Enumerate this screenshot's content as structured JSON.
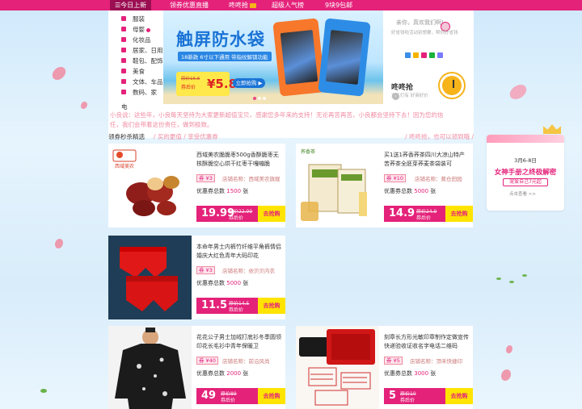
{
  "nav": {
    "items": [
      {
        "label": "今日上新",
        "active": true,
        "icon": "menu-icon"
      },
      {
        "label": "领券优惠直播",
        "active": false
      },
      {
        "label": "咚咚抢",
        "active": false
      },
      {
        "label": "超级人气榜",
        "active": false
      },
      {
        "label": "9块9包邮",
        "active": false
      }
    ],
    "active_color": "#9b0e52",
    "bar_color": "#e4227a"
  },
  "categories": [
    {
      "label": "服装",
      "icon": "clothes-icon"
    },
    {
      "label": "母婴",
      "icon": "baby-icon",
      "hot": true
    },
    {
      "label": "化妆品",
      "icon": "cosmetics-icon"
    },
    {
      "label": "居家、日用",
      "icon": "home-icon"
    },
    {
      "label": "鞋包、配饰",
      "icon": "shoe-icon"
    },
    {
      "label": "美食",
      "icon": "food-icon"
    },
    {
      "label": "文体、车品",
      "icon": "sports-icon"
    },
    {
      "label": "数码、家",
      "icon": "digital-icon"
    }
  ],
  "category_tail": "电",
  "banner": {
    "title": "触屏防水袋",
    "subtitle": "18新款 6寸以下通用 带指纹解锁功能",
    "coupon_orig": "原价15.8",
    "coupon_after": "券后价",
    "coupon_price": "¥5.8",
    "buy_label": "立即抢购 ▶"
  },
  "login": {
    "greeting": "亲你，真欢我们啊!",
    "sub": "好省钱啦活动别想要，帮你好省钱",
    "ddq_title": "咚咚抢",
    "ddq_sub": "女王们有 好商好价"
  },
  "notice": {
    "line1": "小良说：这些年，小良每天坚持为大家更新超值宝贝，感谢您多年来的支持！无论再苦再苦，小良都会坚持下去！因为您的信",
    "line2": "任，我们会带着这份责任，做到极致。"
  },
  "section": {
    "title": "领券秒杀精选",
    "slogan": "/ 买的更值 / 享受优惠券",
    "right": "/ 咚咚抢，也可以领到哦 /"
  },
  "products": [
    {
      "title": "西域美农脆脆枣500g香酥脆枣无核酥脆空心烘干红枣干嘎嘣脆",
      "coupon": "券 ¥3",
      "shop": "店铺名称：西域美农旗舰",
      "sold_label": "优惠券总数",
      "sold_count": "1500",
      "sold_unit": "张",
      "price": "19.99",
      "orig": "原价22.99",
      "after": "券后价",
      "btn": "去抢购",
      "brand": "西域美农"
    },
    {
      "title": "买1送1荞香荞茶四川大凉山特产苦荞茶全胚芽荞麦茶袋装可",
      "coupon": "券 ¥10",
      "shop": "店铺名称：蕉仓田园",
      "sold_label": "优惠券总数",
      "sold_count": "5000",
      "sold_unit": "张",
      "price": "14.9",
      "orig": "原价24.9",
      "after": "券后价",
      "btn": "去抢购",
      "brand": "荞香茶"
    },
    {
      "title": "本命年男士内裤竹纤维平角裤情侣婚庆大红色青年大码印花",
      "coupon": "券 ¥3",
      "shop": "店铺名称：依贝贝内衣",
      "sold_label": "优惠券总数",
      "sold_count": "5000",
      "sold_unit": "张",
      "price": "11.5",
      "orig": "原价14.5",
      "after": "券后价",
      "btn": "去抢购"
    },
    {
      "title": "花花公子男士加绒打底衫冬季圆领印花长毛衫中青年保暖卫",
      "coupon": "券 ¥40",
      "shop": "店铺名称：前沿风尚",
      "sold_label": "优惠券总数",
      "sold_count": "2000",
      "sold_unit": "张",
      "price": "49",
      "orig": "原价89",
      "after": "券后价",
      "btn": "去抢购"
    },
    {
      "title": "刻章长方形光敏印章制作定做宣传快递验收证收名字电话二维码",
      "coupon": "券 ¥5",
      "shop": "店铺名称：顶禾快捷印",
      "sold_label": "优惠券总数",
      "sold_count": "3000",
      "sold_unit": "张",
      "price": "5",
      "orig": "原价10",
      "after": "券后价",
      "btn": "去抢购"
    }
  ],
  "promo": {
    "date": "3月6-8日",
    "title": "女神手册之终极解密",
    "tag": "宠爱自己7元起",
    "more": "点击查看 >>"
  }
}
